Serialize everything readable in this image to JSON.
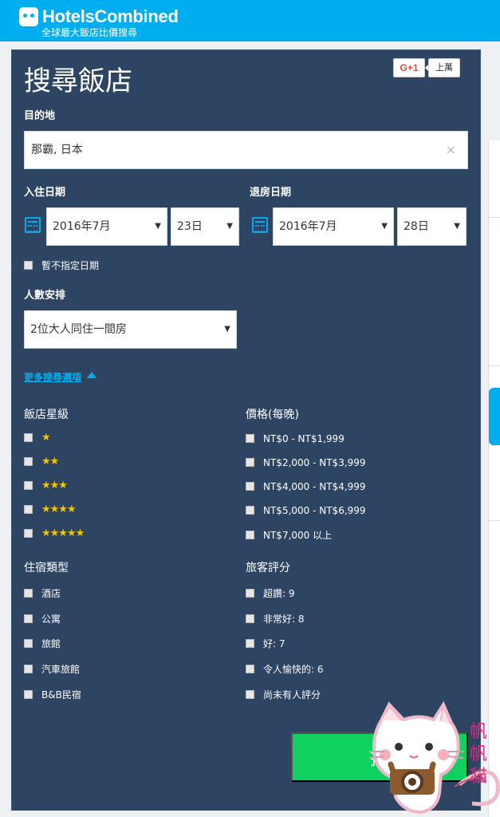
{
  "header": {
    "brand": "HotelsCombined",
    "tagline": "全球最大飯店比價搜尋"
  },
  "social": {
    "gplus_label": "G+1",
    "count_label": "上萬"
  },
  "search": {
    "title": "搜尋飯店",
    "destination_label": "目的地",
    "destination_value": "那霸, 日本",
    "clear_icon": "×",
    "checkin_label": "入住日期",
    "checkin_month": "2016年7月",
    "checkin_day": "23日",
    "checkout_label": "退房日期",
    "checkout_month": "2016年7月",
    "checkout_day": "28日",
    "no_date_label": "暫不指定日期",
    "guests_label": "人數安排",
    "guests_value": "2位大人同住一間房",
    "more_options": "更多搜尋選項",
    "search_button": "搜"
  },
  "filters": {
    "star_title": "飯店星級",
    "stars": [
      "★",
      "★★",
      "★★★",
      "★★★★",
      "★★★★★"
    ],
    "price_title": "價格(每晚)",
    "prices": [
      "NT$0 - NT$1,999",
      "NT$2,000 - NT$3,999",
      "NT$4,000 - NT$4,999",
      "NT$5,000 - NT$6,999",
      "NT$7,000 以上"
    ],
    "type_title": "住宿類型",
    "types": [
      "酒店",
      "公寓",
      "旅館",
      "汽車旅館",
      "B&B民宿"
    ],
    "rating_title": "旅客評分",
    "ratings": [
      "超讚: 9",
      "非常好: 8",
      "好: 7",
      "令人愉快的: 6",
      "尚未有人評分"
    ]
  },
  "watermark": {
    "text": "帆帆貓"
  },
  "colors": {
    "header_blue": "#00aeef",
    "panel_navy": "#2d4463",
    "button_green": "#0ed15f",
    "star_yellow": "#f2c600"
  },
  "icons": [
    "calendar-icon",
    "clear-icon",
    "chevron-down-icon",
    "chevron-up-icon",
    "checkbox-icon",
    "star-icon"
  ]
}
